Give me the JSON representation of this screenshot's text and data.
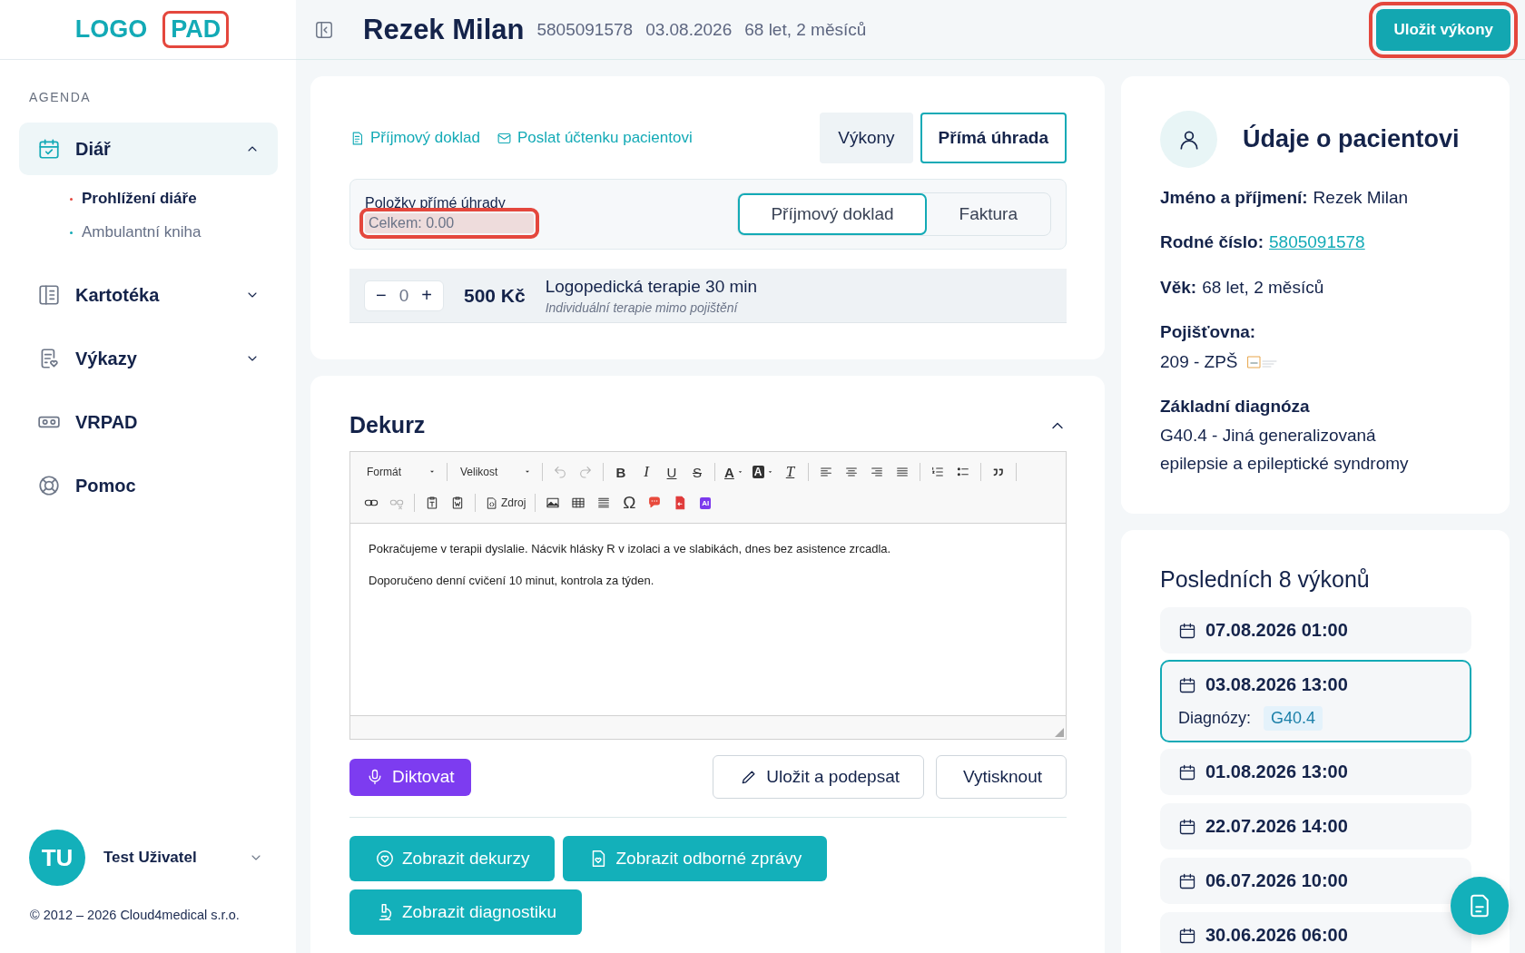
{
  "logo": {
    "parts": [
      {
        "text": "LOGO",
        "highlighted": false
      },
      {
        "text": "PAD",
        "highlighted": true
      }
    ]
  },
  "sidebar": {
    "section": "AGENDA",
    "items": [
      {
        "label": "Diář",
        "selected": true,
        "expanded": true,
        "children": [
          {
            "label": "Prohlížení diáře",
            "selected": true
          },
          {
            "label": "Ambulantní kniha",
            "selected": false
          }
        ]
      },
      {
        "label": "Kartotéka",
        "selected": false,
        "expanded": false
      },
      {
        "label": "Výkazy",
        "selected": false,
        "expanded": false
      },
      {
        "label": "VRPAD",
        "selected": false
      },
      {
        "label": "Pomoc",
        "selected": false
      }
    ]
  },
  "user": {
    "initials": "TU",
    "name": "Test Uživatel"
  },
  "copyright": "© 2012 – 2026 Cloud4medical s.r.o.",
  "header": {
    "name": "Rezek Milan",
    "meta": [
      "5805091578",
      "03.08.2026",
      "68 let, 2 měsíců"
    ],
    "save_button": {
      "label": "Uložit výkony",
      "highlighted": true
    }
  },
  "payment": {
    "links": [
      "Příjmový doklad",
      "Poslat účtenku pacientovi"
    ],
    "tabs": [
      {
        "label": "Výkony",
        "selected": false
      },
      {
        "label": "Přímá úhrada",
        "selected": true
      }
    ],
    "items_title": "Položky přímé úhrady",
    "total": {
      "text": "Celkem: 0.00",
      "highlighted": true
    },
    "doc_types": [
      {
        "label": "Příjmový doklad",
        "selected": true
      },
      {
        "label": "Faktura",
        "selected": false
      }
    ],
    "services": [
      {
        "decrement": "−",
        "quantity": "0",
        "increment": "+",
        "price": "500 Kč",
        "name": "Logopedická terapie 30 min",
        "note": "Individuální terapie mimo pojištění"
      }
    ]
  },
  "dekurz": {
    "title": "Dekurz",
    "expanded": true,
    "toolbar": {
      "format": "Formát",
      "size": "Velikost",
      "bold": "B",
      "italic": "I",
      "underline": "U",
      "strike": "S",
      "font_color": "A",
      "bg_color": "A",
      "clear_format": "T",
      "source": "Zdroj",
      "special_char": "Ω",
      "ai": "AI"
    },
    "paragraphs": [
      "Pokračujeme v terapii dyslalie. Nácvik hlásky R v izolaci a ve slabikách, dnes bez asistence zrcadla.",
      "Doporučeno denní cvičení 10 minut, kontrola za týden."
    ],
    "buttons": [
      {
        "label": "Diktovat",
        "kind": "accent"
      },
      {
        "label": "Uložit a podepsat",
        "kind": "outline"
      },
      {
        "label": "Vytisknout",
        "kind": "outline"
      }
    ],
    "views": [
      "Zobrazit dekurzy",
      "Zobrazit odborné zprávy",
      "Zobrazit diagnostiku"
    ]
  },
  "patient": {
    "title": "Údaje o pacientovi",
    "fields": [
      {
        "label": "Jméno a příjmení:",
        "value": "Rezek Milan",
        "kind": "inline"
      },
      {
        "label": "Rodné číslo:",
        "value": "5805091578",
        "kind": "link"
      },
      {
        "label": "Věk:",
        "value": "68 let, 2 měsíců",
        "kind": "inline"
      },
      {
        "label": "Pojišťovna:",
        "value": "209 - ZPŠ",
        "kind": "insurer"
      },
      {
        "label": "Základní diagnóza",
        "value": "G40.4 - Jiná generalizovaná epilepsie a epileptické syndromy",
        "kind": "block"
      }
    ]
  },
  "recent": {
    "title": "Posledních 8 výkonů",
    "items": [
      {
        "date": "07.08.2026 01:00",
        "selected": false
      },
      {
        "date": "03.08.2026 13:00",
        "selected": true,
        "diagnoses_label": "Diagnózy:",
        "diagnoses": [
          "G40.4"
        ]
      },
      {
        "date": "01.08.2026 13:00",
        "selected": false
      },
      {
        "date": "22.07.2026 14:00",
        "selected": false
      },
      {
        "date": "06.07.2026 10:00",
        "selected": false
      },
      {
        "date": "30.06.2026 06:00",
        "selected": false
      }
    ]
  }
}
